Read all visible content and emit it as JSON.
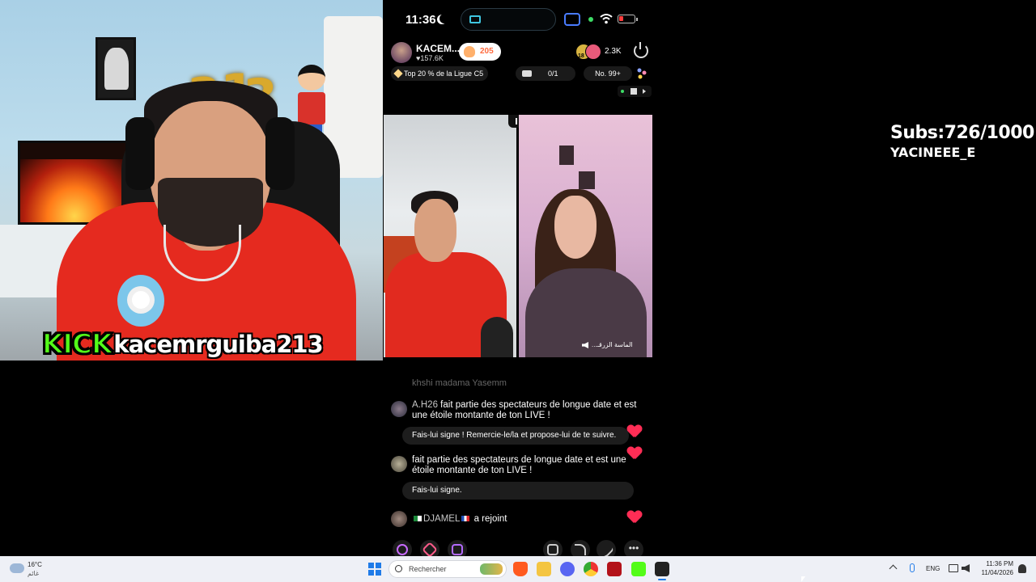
{
  "webcam": {
    "platform_brand": "KICK",
    "username": "kacemrguiba213",
    "balloon_digits": [
      "2",
      "1",
      "3"
    ]
  },
  "phone": {
    "status": {
      "time": "11:36"
    },
    "host": {
      "name": "KACEM...",
      "likes": "♥157.6K",
      "follow_count": "205",
      "viewer_badge": "18",
      "viewer_count": "2.3K"
    },
    "league": {
      "text": "Top 20 % de la Ligue C5",
      "gift_progress": "0/1",
      "rank": "No. 99+"
    },
    "guest": {
      "label": "...الماسة الزرقـ"
    },
    "chat": {
      "faded_line": "khshi madama Yasemm",
      "messages": [
        {
          "user": "A.H26",
          "text": "fait partie des spectateurs de longue date et est une étoile montante de ton LIVE !",
          "suggestion": "Fais-lui signe ! Remercie-le/la et propose-lui de te suivre."
        },
        {
          "user": "",
          "text": "fait partie des spectateurs de longue date et est une étoile montante de ton LIVE !",
          "suggestion": "Fais-lui signe."
        }
      ],
      "join": {
        "user": "DJAMEL",
        "action": "a rejoint"
      }
    }
  },
  "overlay": {
    "subs_goal": "Subs:726/1000",
    "channel": "YACINEEE_E"
  },
  "taskbar": {
    "weather_temp": "16°C",
    "weather_label": "غائم",
    "search_label": "Rechercher",
    "language": "ENG",
    "clock_time": "11:36 PM",
    "clock_date": "11/04/2026"
  },
  "colors": {
    "kick_green": "#53fc18",
    "heart_red": "#ff2d55",
    "windows_blue": "#1f7be8",
    "shirt_red": "#e52a1f"
  }
}
